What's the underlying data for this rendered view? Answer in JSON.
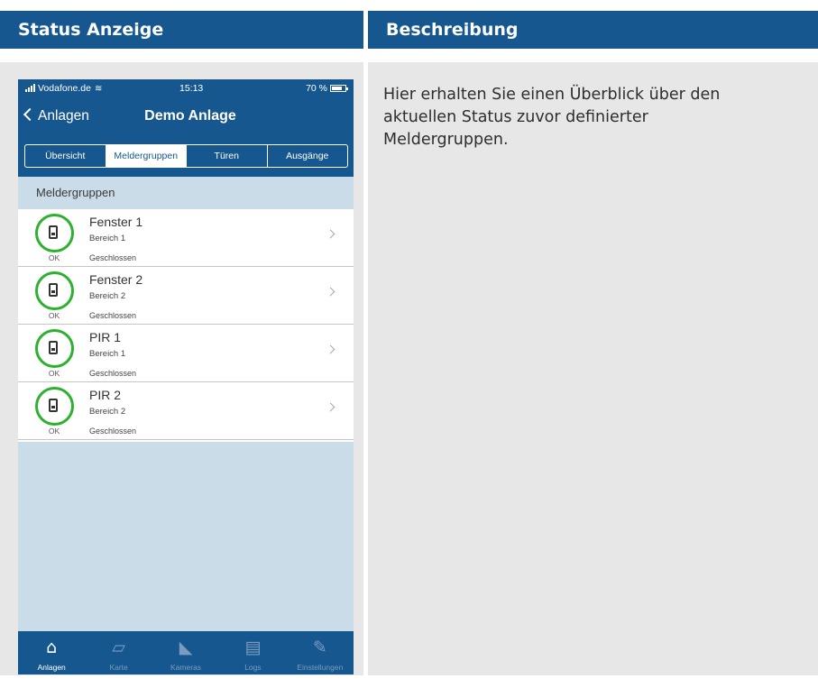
{
  "table": {
    "header_left": "Status Anzeige",
    "header_right": "Beschreibung",
    "description": "Hier erhalten Sie einen Überblick über den aktuellen Status zuvor definierter Meldergruppen."
  },
  "phone": {
    "status_bar": {
      "carrier": "Vodafone.de",
      "time": "15:13",
      "battery": "70 %"
    },
    "nav": {
      "back_label": "Anlagen",
      "title": "Demo Anlage"
    },
    "segments": [
      {
        "label": "Übersicht",
        "active": false
      },
      {
        "label": "Meldergruppen",
        "active": true
      },
      {
        "label": "Türen",
        "active": false
      },
      {
        "label": "Ausgänge",
        "active": false
      }
    ],
    "section_header": "Meldergruppen",
    "groups": [
      {
        "name": "Fenster 1",
        "area": "Bereich 1",
        "status": "OK",
        "state": "Geschlossen"
      },
      {
        "name": "Fenster 2",
        "area": "Bereich 2",
        "status": "OK",
        "state": "Geschlossen"
      },
      {
        "name": "PIR 1",
        "area": "Bereich 1",
        "status": "OK",
        "state": "Geschlossen"
      },
      {
        "name": "PIR 2",
        "area": "Bereich 2",
        "status": "OK",
        "state": "Geschlossen"
      }
    ],
    "tabbar": [
      {
        "label": "Anlagen",
        "icon": "home-icon",
        "active": true
      },
      {
        "label": "Karte",
        "icon": "map-icon",
        "active": false
      },
      {
        "label": "Kameras",
        "icon": "camera-icon",
        "active": false
      },
      {
        "label": "Logs",
        "icon": "logs-icon",
        "active": false
      },
      {
        "label": "Einstellungen",
        "icon": "wrench-icon",
        "active": false
      }
    ]
  },
  "colors": {
    "brand_blue": "#16578f",
    "status_ok": "#2eb12e",
    "panel_bg": "#c9dce8",
    "cell_bg": "#e7e7e7"
  }
}
